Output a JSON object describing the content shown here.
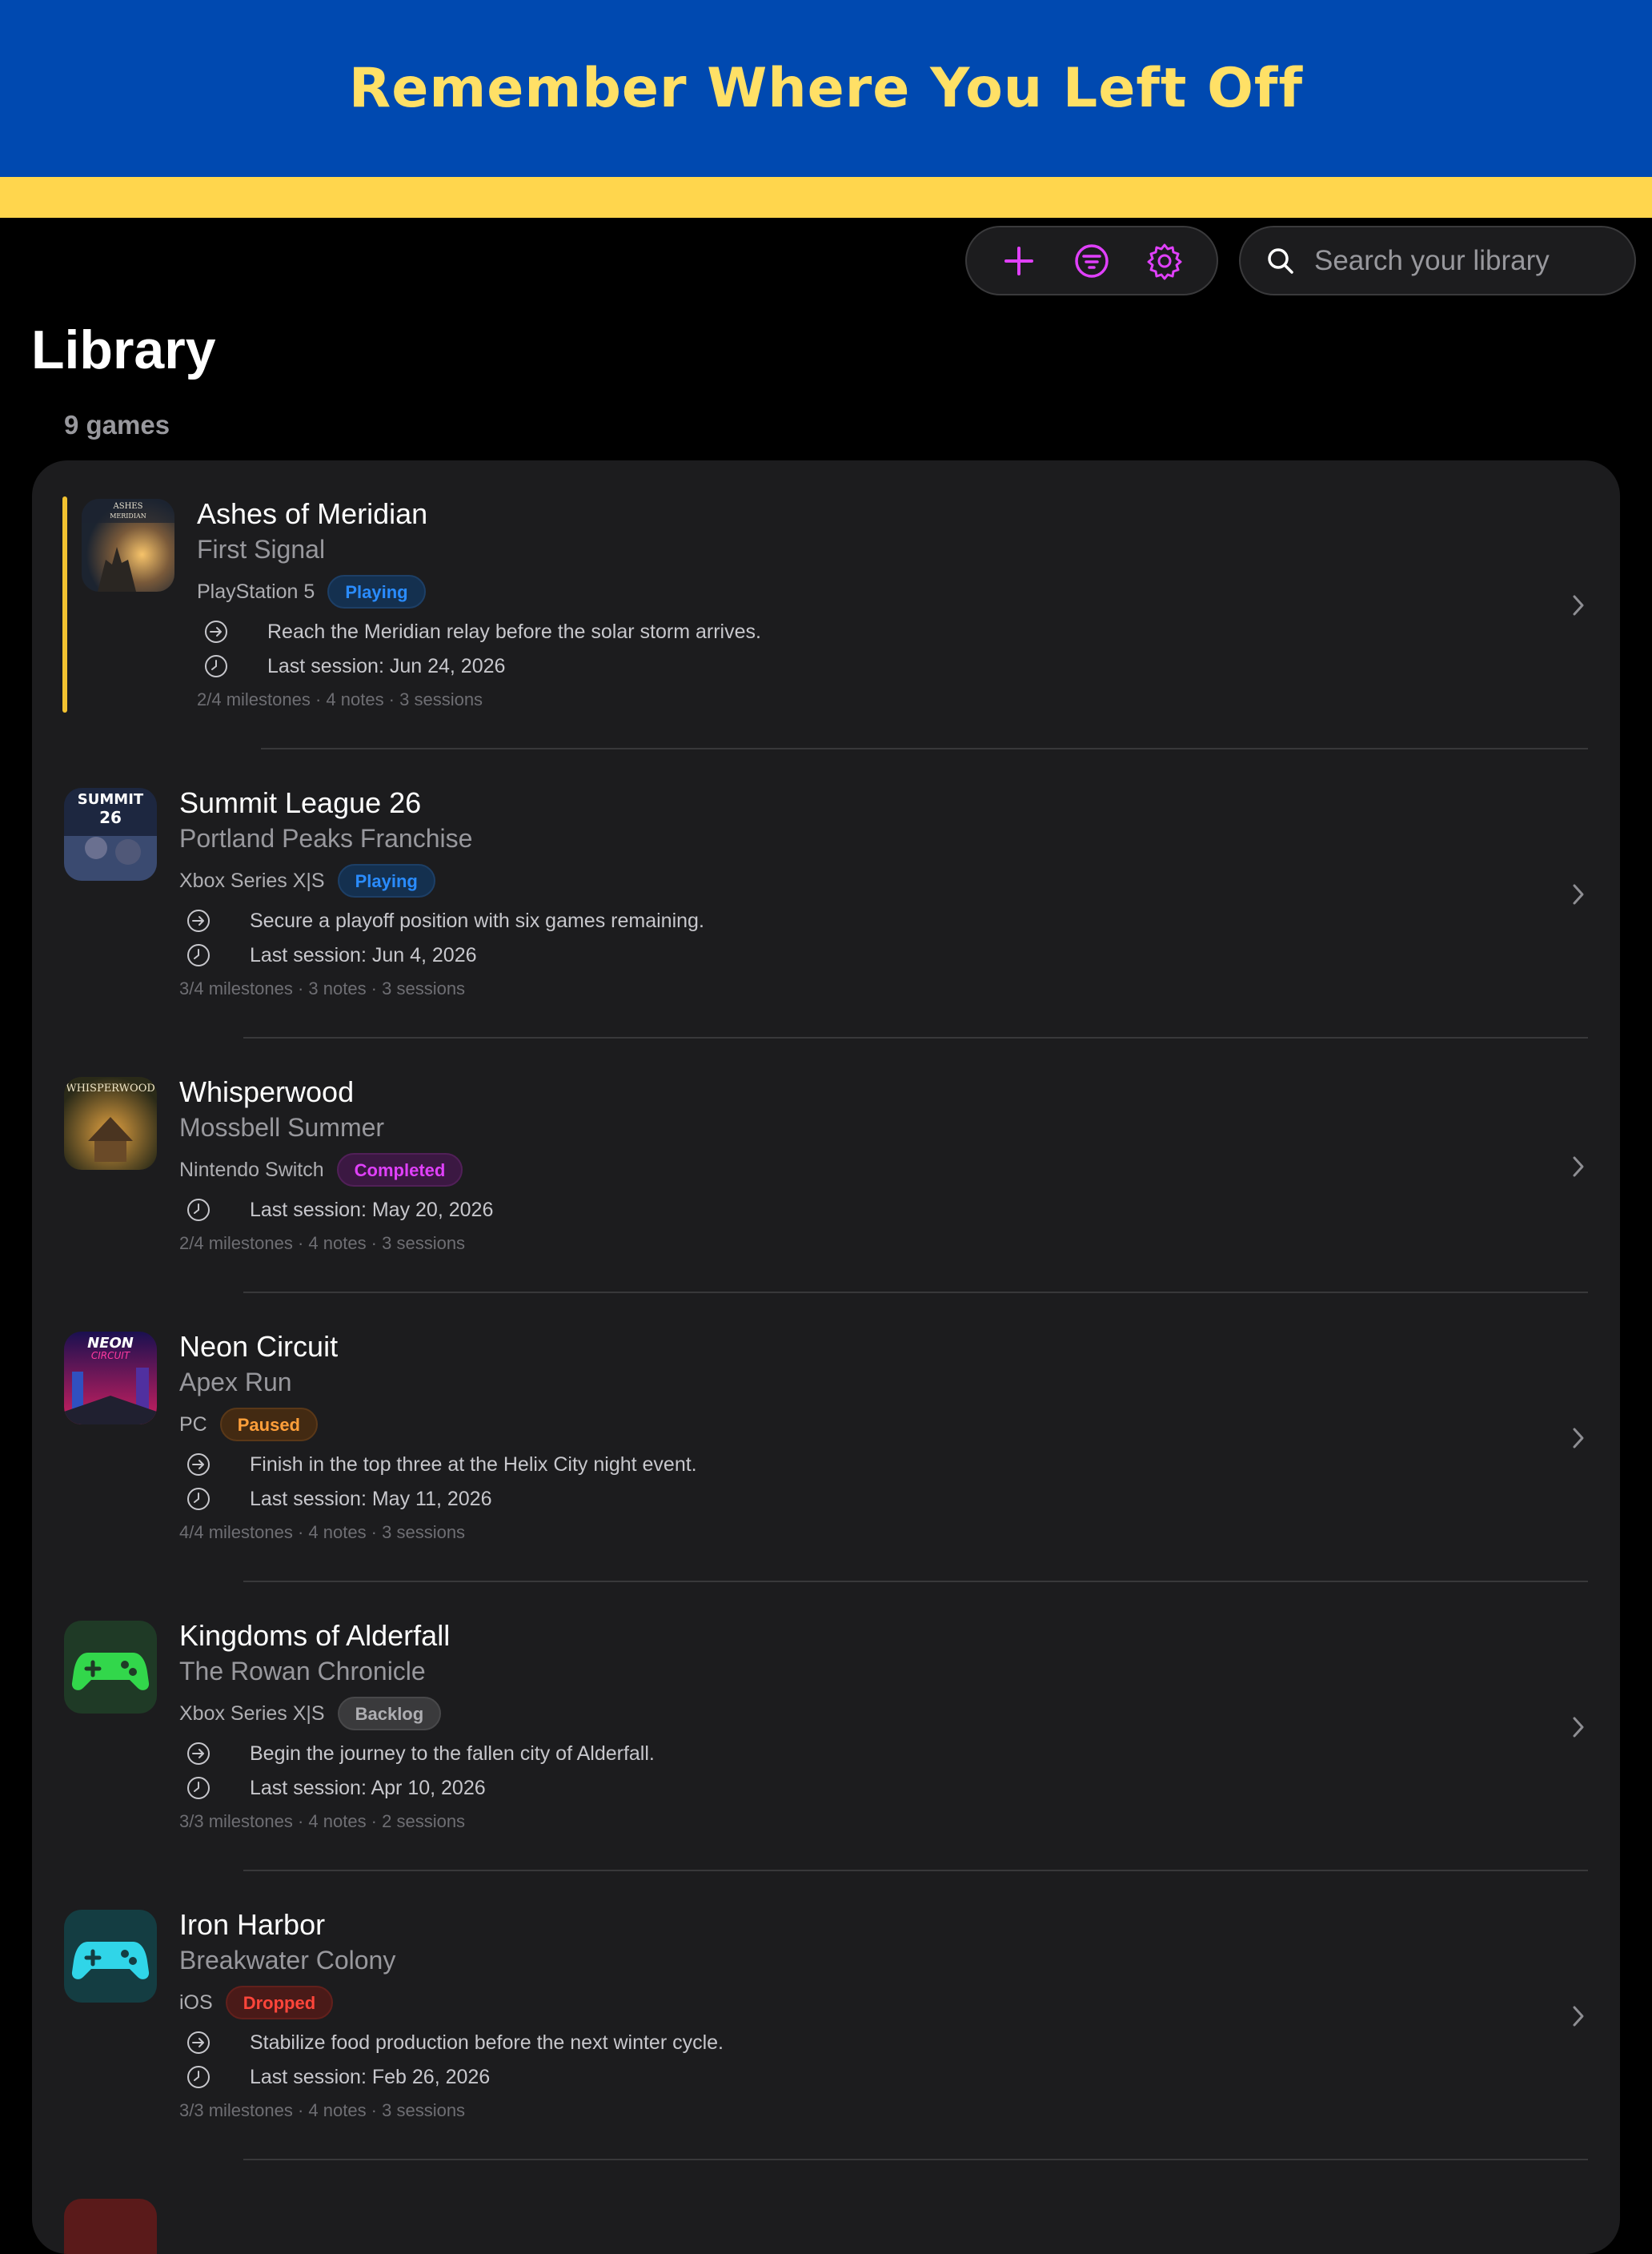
{
  "banner": {
    "title": "Remember Where You Left Off"
  },
  "toolbar": {
    "add_icon": "plus-icon",
    "filter_icon": "filter-icon",
    "settings_icon": "gear-icon",
    "accent_color": "#e040fb"
  },
  "search": {
    "placeholder": "Search your library",
    "value": ""
  },
  "library": {
    "title": "Library",
    "count": "9 games",
    "games": [
      {
        "title": "Ashes of Meridian",
        "subtitle": "First Signal",
        "platform": "PlayStation 5",
        "status": "Playing",
        "objective": "Reach the Meridian relay before the solar storm arrives.",
        "last_session": "Last session: Jun 24, 2026",
        "stats": "2/4 milestones · 4 notes · 3 sessions",
        "highlighted": true
      },
      {
        "title": "Summit League 26",
        "subtitle": "Portland Peaks Franchise",
        "platform": "Xbox Series X|S",
        "status": "Playing",
        "objective": "Secure a playoff position with six games remaining.",
        "last_session": "Last session: Jun 4, 2026",
        "stats": "3/4 milestones · 3 notes · 3 sessions"
      },
      {
        "title": "Whisperwood",
        "subtitle": "Mossbell Summer",
        "platform": "Nintendo Switch",
        "status": "Completed",
        "objective": "",
        "last_session": "Last session: May 20, 2026",
        "stats": "2/4 milestones · 4 notes · 3 sessions"
      },
      {
        "title": "Neon Circuit",
        "subtitle": "Apex Run",
        "platform": "PC",
        "status": "Paused",
        "objective": "Finish in the top three at the Helix City night event.",
        "last_session": "Last session: May 11, 2026",
        "stats": "4/4 milestones · 4 notes · 3 sessions"
      },
      {
        "title": "Kingdoms of Alderfall",
        "subtitle": "The Rowan Chronicle",
        "platform": "Xbox Series X|S",
        "status": "Backlog",
        "objective": "Begin the journey to the fallen city of Alderfall.",
        "last_session": "Last session: Apr 10, 2026",
        "stats": "3/3 milestones · 4 notes · 2 sessions"
      },
      {
        "title": "Iron Harbor",
        "subtitle": "Breakwater Colony",
        "platform": "iOS",
        "status": "Dropped",
        "objective": "Stabilize food production before the next winter cycle.",
        "last_session": "Last session: Feb 26, 2026",
        "stats": "3/3 milestones · 4 notes · 3 sessions"
      }
    ]
  }
}
